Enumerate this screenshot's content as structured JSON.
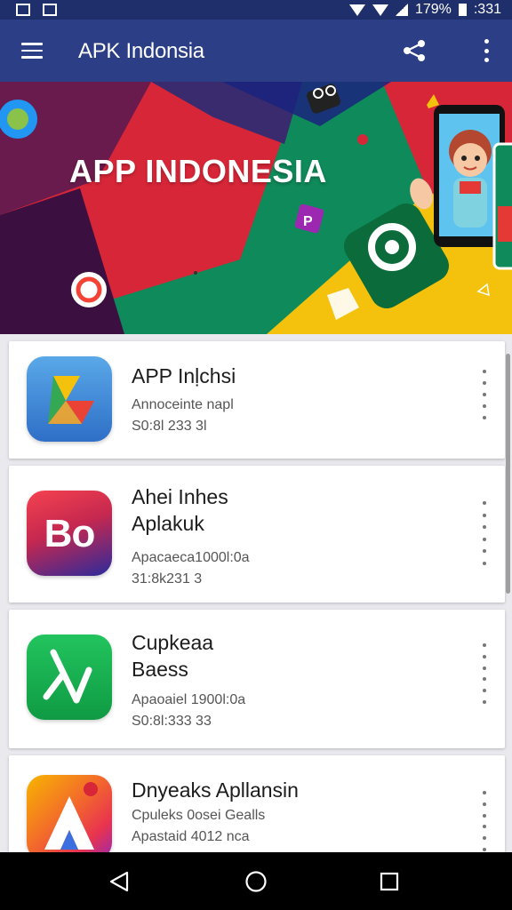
{
  "status_bar": {
    "battery_percent": "179%",
    "time": ":331"
  },
  "app_bar": {
    "title": "APK Indonsia",
    "icons": [
      "menu-icon",
      "share-icon",
      "more-vert-icon"
    ]
  },
  "banner": {
    "title": "APP INDONESIA"
  },
  "apps": [
    {
      "title_line1": "APP Inḷchsi",
      "title_line2": "",
      "sub_line1": "Annoceinte napl",
      "sub_line2": "S0:8l 233 3l"
    },
    {
      "title_line1": "Ahei Inhes",
      "title_line2": "Aplakuk",
      "sub_line1": "Apacaeca1000l:0a",
      "sub_line2": "31:8k231 3"
    },
    {
      "title_line1": "Cupkeaa",
      "title_line2": "Baess",
      "sub_line1": "Apaoaiel 1900l:0a",
      "sub_line2": "S0:8l:333 33"
    },
    {
      "title_line1": "Dnyeaks Apllansin",
      "title_line2": "",
      "sub_line1": "Cpuleks 0osei Gealls",
      "sub_line2": "Apastaid 4012 nca"
    }
  ],
  "icon_text": {
    "bo": "Bo"
  },
  "colors": {
    "status_bar": "#1f2f6b",
    "app_bar": "#2c3e86",
    "banner_red": "#d72638",
    "banner_green": "#0f8a5a",
    "banner_yellow": "#f4c20d"
  }
}
